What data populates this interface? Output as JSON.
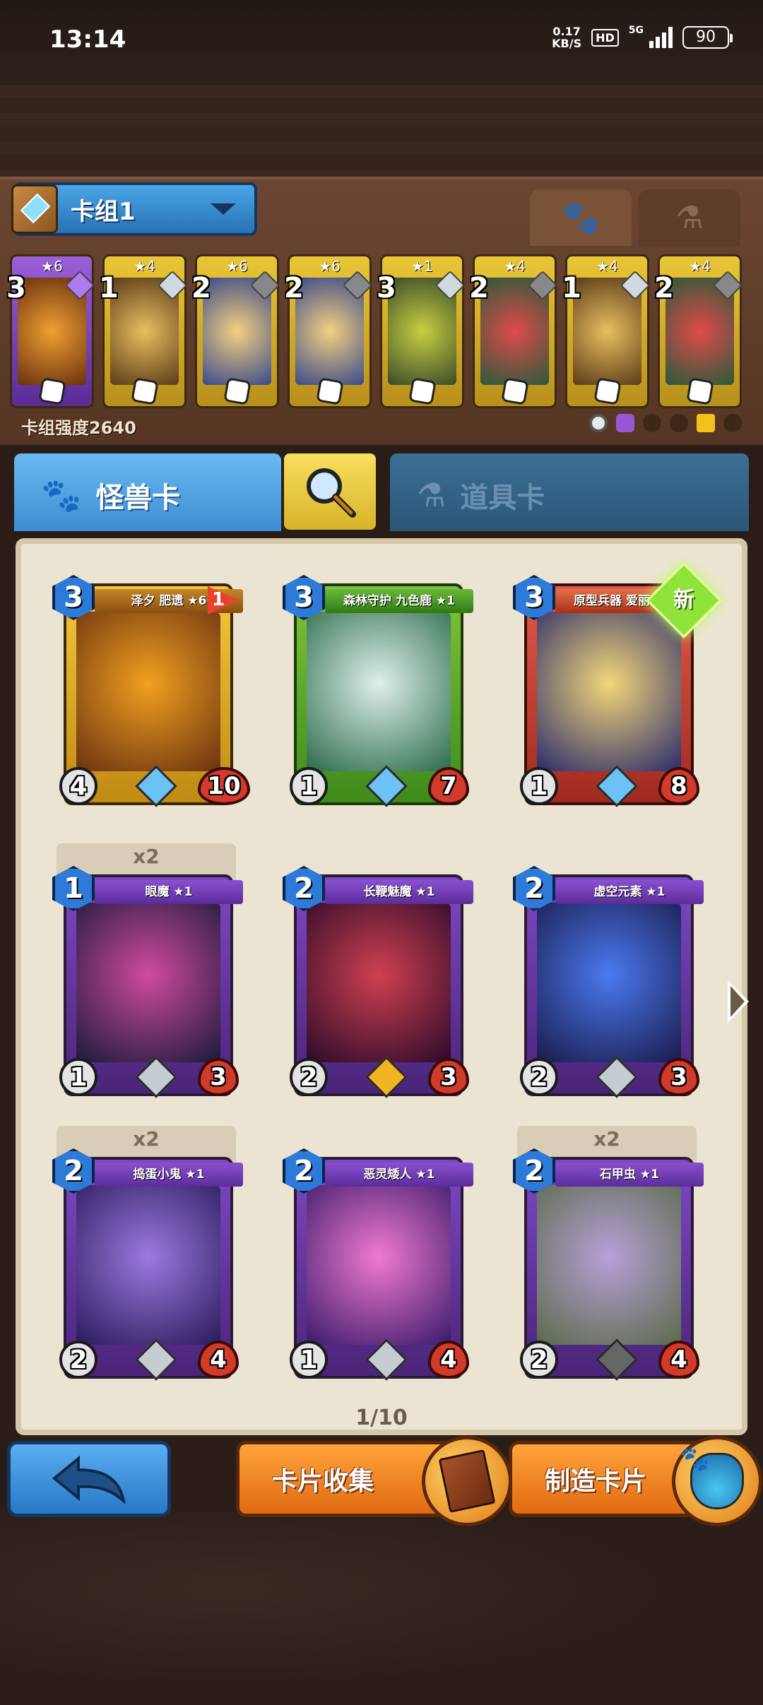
{
  "status_bar": {
    "time": "13:14",
    "net_speed_value": "0.17",
    "net_speed_unit": "KB/S",
    "hd": "HD",
    "network": "5G",
    "battery": "90"
  },
  "deck": {
    "selector_label": "卡组1",
    "strength_label": "卡组强度2640",
    "tabs": [
      {
        "icon": "paw-icon",
        "active": true
      },
      {
        "icon": "flask-icon",
        "active": false
      }
    ],
    "cards": [
      {
        "cost": "3",
        "stars": "★6",
        "frame": "purple"
      },
      {
        "cost": "1",
        "stars": "★4",
        "frame": "gold"
      },
      {
        "cost": "2",
        "stars": "★6",
        "frame": "gold"
      },
      {
        "cost": "2",
        "stars": "★6",
        "frame": "gold"
      },
      {
        "cost": "3",
        "stars": "★1",
        "frame": "gold"
      },
      {
        "cost": "2",
        "stars": "★4",
        "frame": "gold"
      },
      {
        "cost": "1",
        "stars": "★4",
        "frame": "gold"
      },
      {
        "cost": "2",
        "stars": "★4",
        "frame": "gold"
      }
    ]
  },
  "category_tabs": {
    "monster": "怪兽卡",
    "item": "道具卡",
    "search_icon": "magnifier-icon"
  },
  "collection": {
    "page": "1/10",
    "cards": [
      {
        "name": "泽夕 肥遗 ★6",
        "cost": "3",
        "attack": "4",
        "health": "10",
        "frame": "gold",
        "flag": "1",
        "count": "",
        "new": false
      },
      {
        "name": "森林守护 九色鹿 ★1",
        "cost": "3",
        "attack": "1",
        "health": "7",
        "frame": "green",
        "flag": "",
        "count": "",
        "new": false
      },
      {
        "name": "原型兵器 爱丽丝 ★1",
        "cost": "3",
        "attack": "1",
        "health": "8",
        "frame": "red",
        "flag": "",
        "count": "",
        "new": true,
        "new_label": "新"
      },
      {
        "name": "眼魔 ★1",
        "cost": "1",
        "attack": "1",
        "health": "3",
        "frame": "purple",
        "flag": "",
        "count": "x2",
        "new": false
      },
      {
        "name": "长鞭魅魔 ★1",
        "cost": "2",
        "attack": "2",
        "health": "3",
        "frame": "purple",
        "flag": "",
        "count": "",
        "new": false
      },
      {
        "name": "虚空元素 ★1",
        "cost": "2",
        "attack": "2",
        "health": "3",
        "frame": "purple",
        "flag": "",
        "count": "",
        "new": false
      },
      {
        "name": "捣蛋小鬼 ★1",
        "cost": "2",
        "attack": "2",
        "health": "4",
        "frame": "purple",
        "flag": "",
        "count": "x2",
        "new": false
      },
      {
        "name": "恶灵矮人 ★1",
        "cost": "2",
        "attack": "1",
        "health": "4",
        "frame": "purple",
        "flag": "",
        "count": "",
        "new": false
      },
      {
        "name": "石甲虫 ★1",
        "cost": "2",
        "attack": "2",
        "health": "4",
        "frame": "purple",
        "flag": "",
        "count": "x2",
        "new": false
      }
    ]
  },
  "buttons": {
    "back_icon": "back-arrow-icon",
    "collect": "卡片收集",
    "craft": "制造卡片"
  }
}
